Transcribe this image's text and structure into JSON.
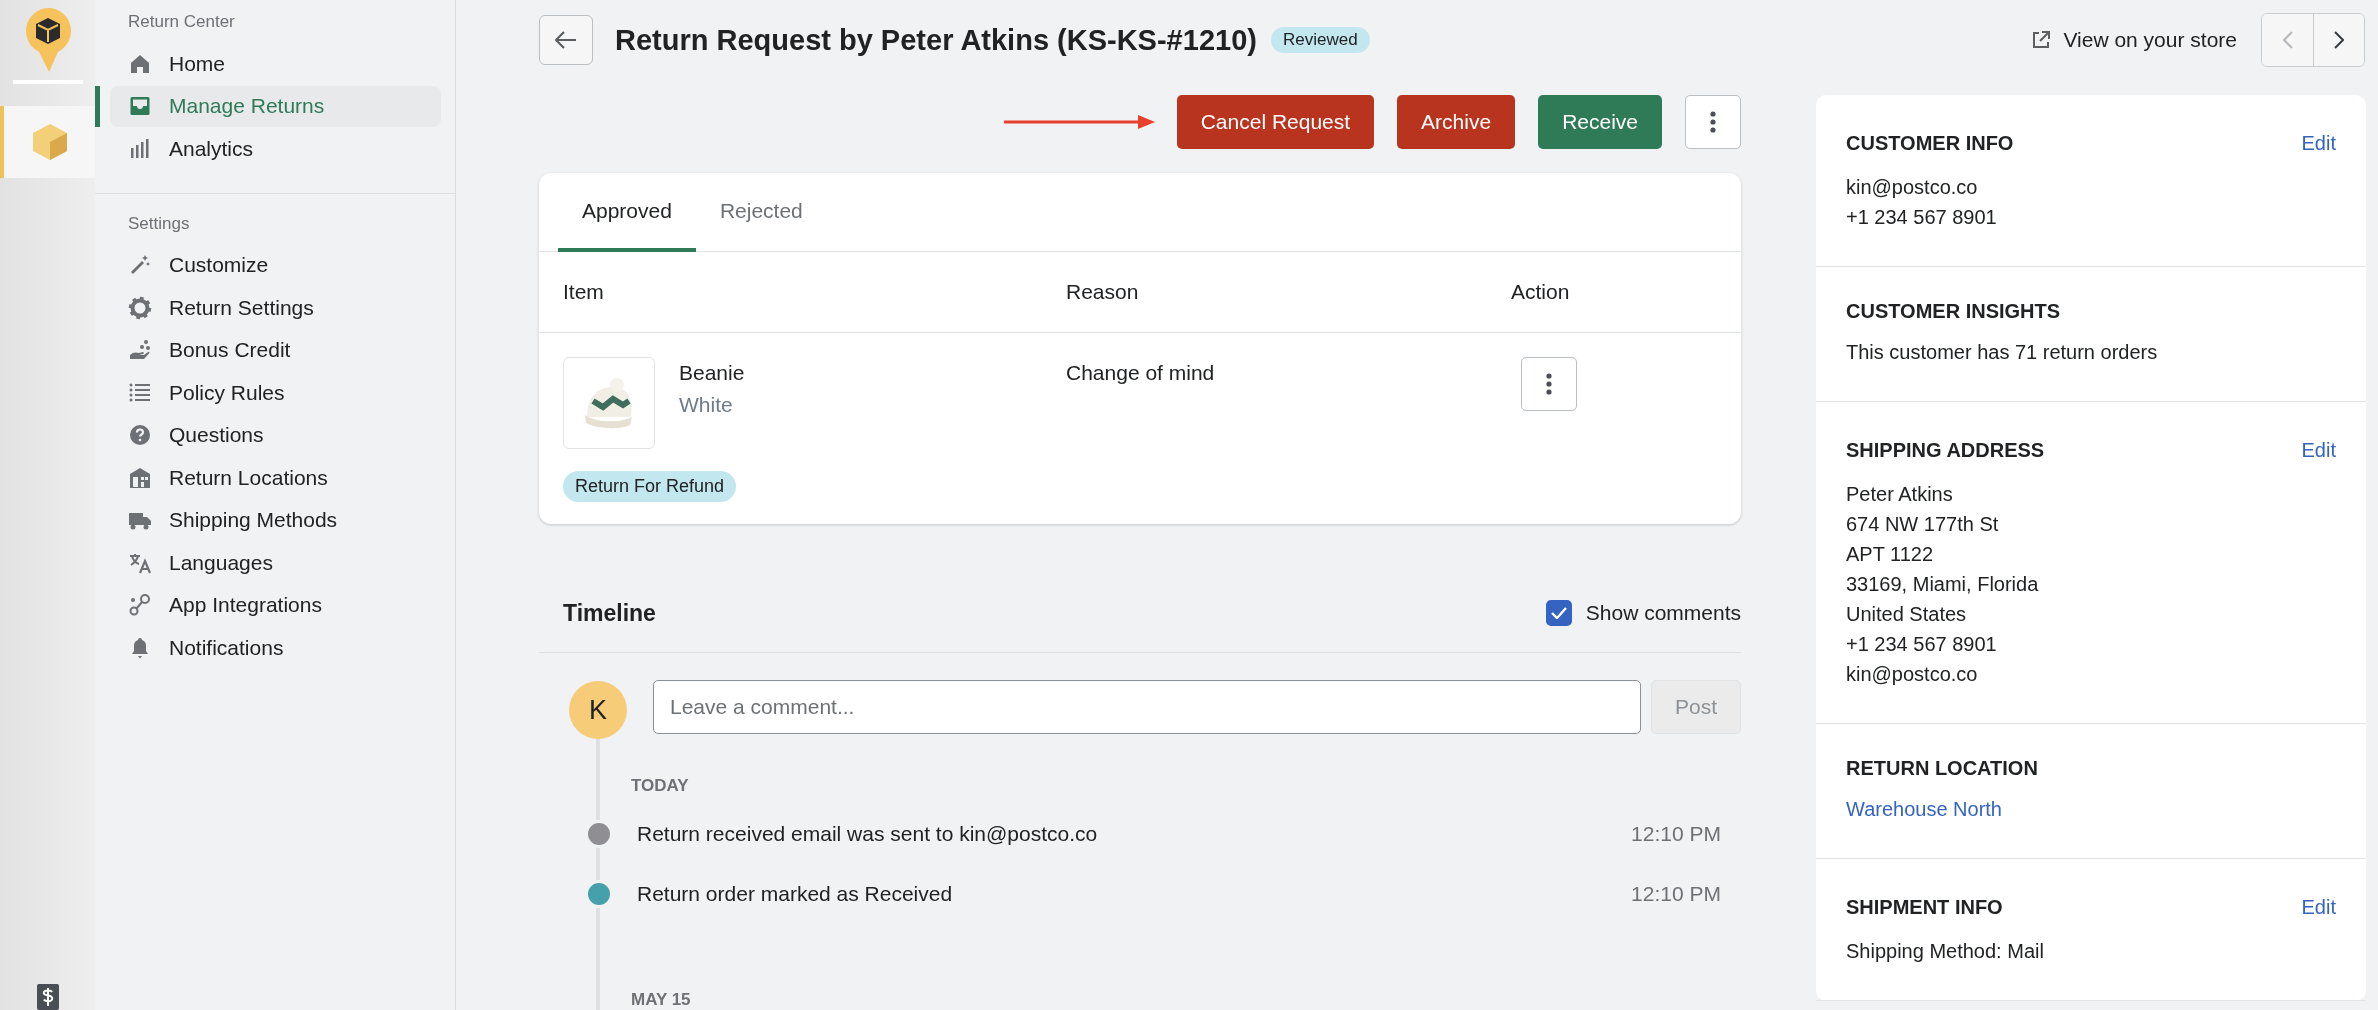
{
  "sidebar": {
    "sections": [
      {
        "title": "Return Center",
        "items": [
          {
            "label": "Home",
            "selected": false
          },
          {
            "label": "Manage Returns",
            "selected": true
          },
          {
            "label": "Analytics",
            "selected": false
          }
        ]
      },
      {
        "title": "Settings",
        "items": [
          {
            "label": "Customize",
            "selected": false
          },
          {
            "label": "Return Settings",
            "selected": false
          },
          {
            "label": "Bonus Credit",
            "selected": false
          },
          {
            "label": "Policy Rules",
            "selected": false
          },
          {
            "label": "Questions",
            "selected": false
          },
          {
            "label": "Return Locations",
            "selected": false
          },
          {
            "label": "Shipping Methods",
            "selected": false
          },
          {
            "label": "Languages",
            "selected": false
          },
          {
            "label": "App Integrations",
            "selected": false
          },
          {
            "label": "Notifications",
            "selected": false
          }
        ]
      }
    ]
  },
  "header": {
    "title": "Return Request by Peter Atkins (KS-KS-#1210)",
    "status": "Reviewed",
    "store_link": "View on your store"
  },
  "actions": [
    {
      "label": "Cancel Request",
      "kind": "danger"
    },
    {
      "label": "Archive",
      "kind": "danger"
    },
    {
      "label": "Receive",
      "kind": "primary"
    }
  ],
  "tabs": [
    {
      "label": "Approved",
      "selected": true
    },
    {
      "label": "Rejected",
      "selected": false
    }
  ],
  "table": {
    "columns": [
      "Item",
      "Reason",
      "Action"
    ],
    "rows": [
      {
        "name": "Beanie",
        "variant": "White",
        "reason": "Change of mind",
        "tag": "Return For Refund"
      }
    ]
  },
  "timeline": {
    "title": "Timeline",
    "show_comments": {
      "label": "Show comments",
      "checked": true
    },
    "avatar": "K",
    "comment": {
      "placeholder": "Leave a comment..."
    },
    "post": {
      "label": "Post",
      "disabled": true
    },
    "groups": [
      {
        "date": "TODAY",
        "events": [
          {
            "text": "Return received email was sent to kin@postco.co",
            "time": "12:10 PM",
            "color": "#8e8e93"
          },
          {
            "text": "Return order marked as Received",
            "time": "12:10 PM",
            "color": "#46a0ac"
          }
        ]
      },
      {
        "date": "MAY 15"
      }
    ]
  },
  "panel": [
    {
      "title": "CUSTOMER INFO",
      "action": "Edit",
      "lines": [
        "kin@postco.co",
        "+1 234 567 8901"
      ]
    },
    {
      "title": "CUSTOMER INSIGHTS",
      "lines": [
        "This customer has 71 return orders"
      ]
    },
    {
      "title": "SHIPPING ADDRESS",
      "action": "Edit",
      "lines": [
        "Peter Atkins",
        "674 NW 177th St",
        "APT 1122",
        "33169, Miami, Florida",
        "United States",
        "+1 234 567 8901",
        "kin@postco.co"
      ]
    },
    {
      "title": "RETURN LOCATION",
      "link": "Warehouse North"
    },
    {
      "title": "SHIPMENT INFO",
      "action": "Edit",
      "lines": [
        "Shipping Method: Mail"
      ]
    }
  ]
}
